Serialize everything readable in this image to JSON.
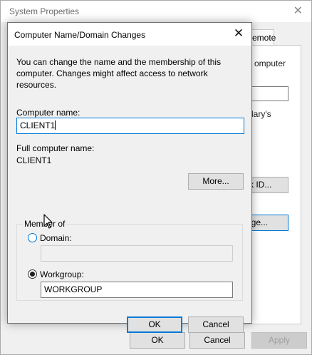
{
  "background_window": {
    "title": "System Properties",
    "tab_partial": "emote",
    "panel_text_1": "omputer",
    "panel_text_2": "lary's",
    "network_id_button": "rk ID...",
    "change_button": "nge...",
    "ok_label": "OK",
    "cancel_label": "Cancel",
    "apply_label": "Apply"
  },
  "dialog": {
    "title": "Computer Name/Domain Changes",
    "description": "You can change the name and the membership of this computer. Changes might affect access to network resources.",
    "computer_name_label": "Computer name:",
    "computer_name_value": "CLIENT1",
    "full_name_label": "Full computer name:",
    "full_name_value": "CLIENT1",
    "more_button": "More...",
    "member_of": {
      "legend": "Member of",
      "domain_label": "Domain:",
      "domain_value": "",
      "workgroup_label": "Workgroup:",
      "workgroup_value": "WORKGROUP",
      "selected": "workgroup"
    },
    "ok_label": "OK",
    "cancel_label": "Cancel"
  },
  "colors": {
    "focus_accent": "#0078d7",
    "window_bg": "#f0f0f0"
  }
}
